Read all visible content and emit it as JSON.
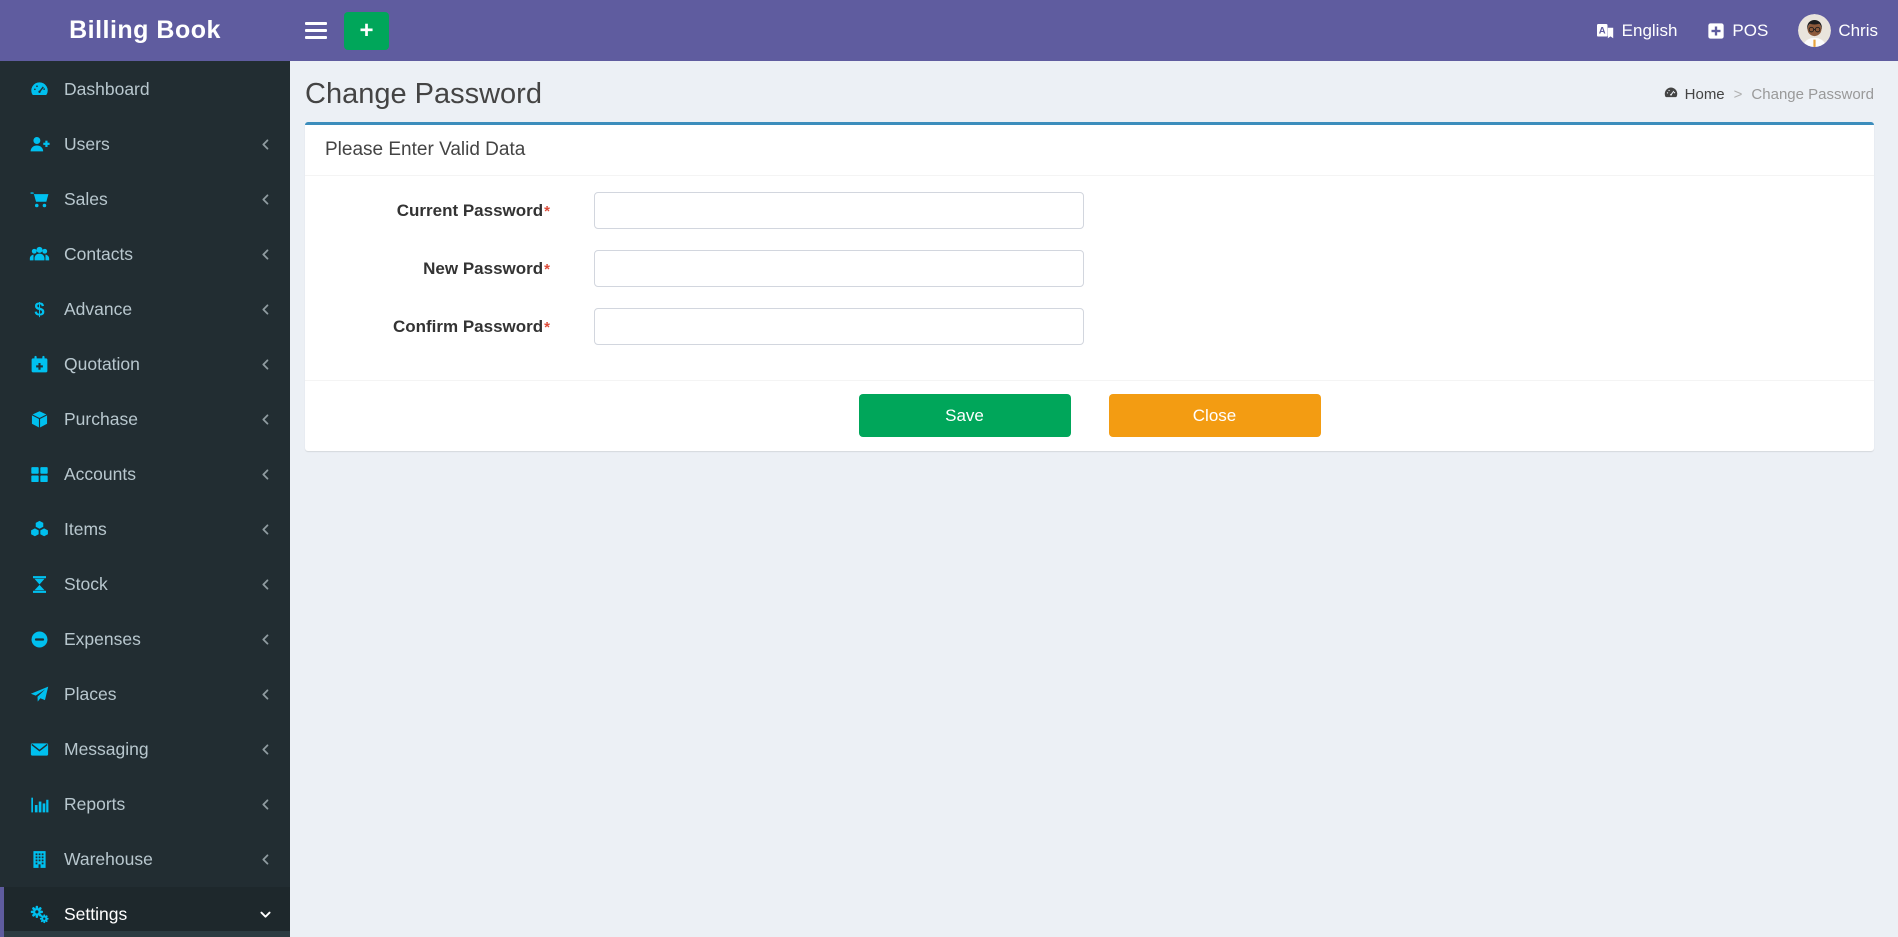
{
  "app": {
    "logo": "Billing Book"
  },
  "header": {
    "language_label": "English",
    "pos_label": "POS",
    "user_name": "Chris",
    "add_button": "+"
  },
  "sidebar": {
    "items": [
      {
        "label": "Dashboard",
        "icon": "dashboard-icon",
        "chevron": "none",
        "active": false
      },
      {
        "label": "Users",
        "icon": "user-plus-icon",
        "chevron": "left",
        "active": false
      },
      {
        "label": "Sales",
        "icon": "cart-icon",
        "chevron": "left",
        "active": false
      },
      {
        "label": "Contacts",
        "icon": "users-icon",
        "chevron": "left",
        "active": false
      },
      {
        "label": "Advance",
        "icon": "dollar-icon",
        "chevron": "left",
        "active": false
      },
      {
        "label": "Quotation",
        "icon": "calendar-plus-icon",
        "chevron": "left",
        "active": false
      },
      {
        "label": "Purchase",
        "icon": "cube-icon",
        "chevron": "left",
        "active": false
      },
      {
        "label": "Accounts",
        "icon": "grid-icon",
        "chevron": "left",
        "active": false
      },
      {
        "label": "Items",
        "icon": "cubes-icon",
        "chevron": "left",
        "active": false
      },
      {
        "label": "Stock",
        "icon": "hourglass-icon",
        "chevron": "left",
        "active": false
      },
      {
        "label": "Expenses",
        "icon": "minus-circle-icon",
        "chevron": "left",
        "active": false
      },
      {
        "label": "Places",
        "icon": "paper-plane-icon",
        "chevron": "left",
        "active": false
      },
      {
        "label": "Messaging",
        "icon": "envelope-icon",
        "chevron": "left",
        "active": false
      },
      {
        "label": "Reports",
        "icon": "bar-chart-icon",
        "chevron": "left",
        "active": false
      },
      {
        "label": "Warehouse",
        "icon": "building-icon",
        "chevron": "left",
        "active": false
      },
      {
        "label": "Settings",
        "icon": "gears-icon",
        "chevron": "down",
        "active": true
      }
    ]
  },
  "page": {
    "title": "Change Password",
    "breadcrumb": {
      "home_label": "Home",
      "separator": ">",
      "current": "Change Password"
    }
  },
  "form": {
    "card_title": "Please Enter Valid Data",
    "required_marker": "*",
    "fields": [
      {
        "label": "Current Password",
        "name": "current-password",
        "value": "",
        "placeholder": ""
      },
      {
        "label": "New Password",
        "name": "new-password",
        "value": "",
        "placeholder": ""
      },
      {
        "label": "Confirm Password",
        "name": "confirm-password",
        "value": "",
        "placeholder": ""
      }
    ],
    "buttons": {
      "save": "Save",
      "close": "Close"
    }
  },
  "colors": {
    "header_purple": "#5f5c9f",
    "sidebar_dark": "#222d32",
    "sidebar_active_bg": "#1e282c",
    "icon_cyan": "#00c0ef",
    "card_top_border": "#3c8dbc",
    "save_green": "#00a65a",
    "close_orange": "#f39c12",
    "required_red": "#dd4b39",
    "content_bg": "#ecf0f5"
  }
}
